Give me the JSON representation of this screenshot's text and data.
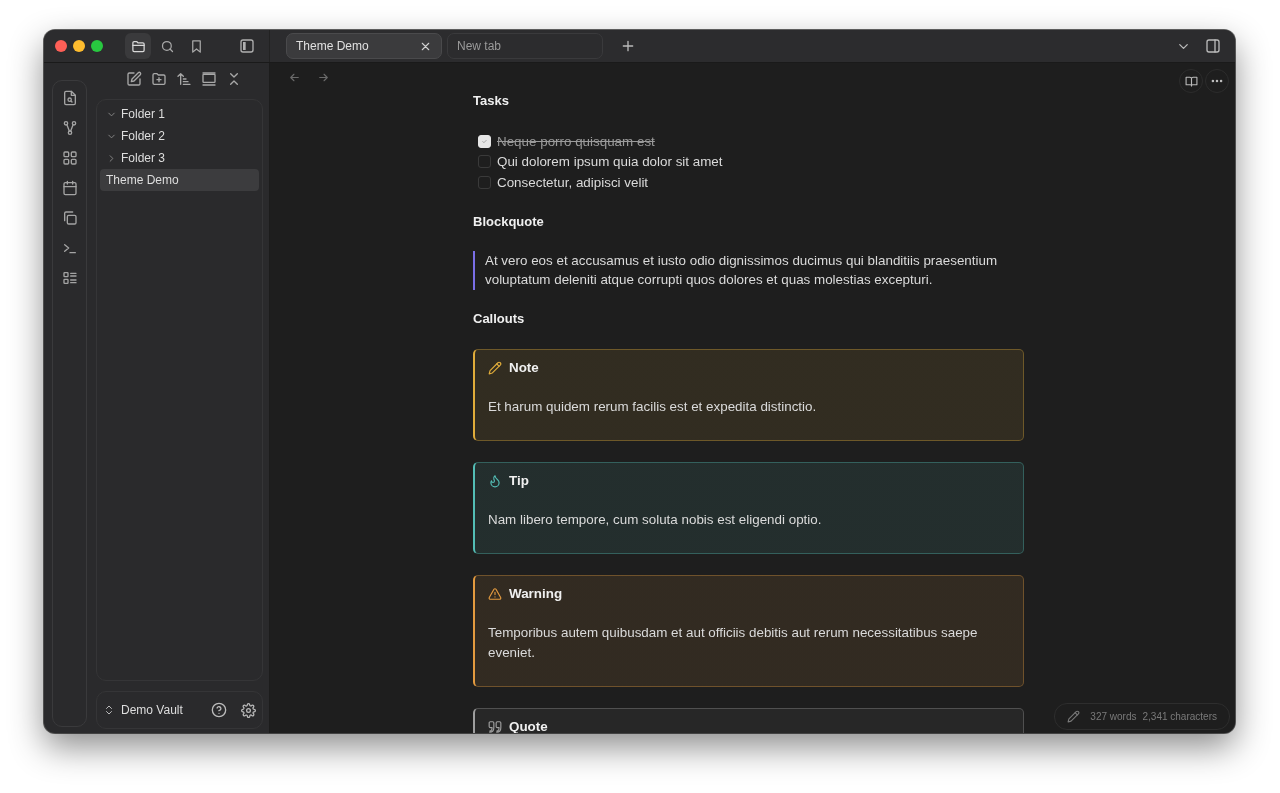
{
  "nav_tabs": [
    {
      "kind": "files",
      "selected": true
    },
    {
      "kind": "search",
      "selected": false
    },
    {
      "kind": "bookmarks",
      "selected": false
    }
  ],
  "tabs": [
    {
      "label": "Theme Demo",
      "selected": true
    },
    {
      "label": "New tab",
      "selected": false
    }
  ],
  "file_tree": [
    {
      "label": "Folder 1",
      "kind": "folder",
      "expanded": true,
      "selected": false
    },
    {
      "label": "Folder 2",
      "kind": "folder",
      "expanded": true,
      "selected": false
    },
    {
      "label": "Folder 3",
      "kind": "folder",
      "expanded": false,
      "selected": false
    },
    {
      "label": "Theme Demo",
      "kind": "file",
      "selected": true
    }
  ],
  "vault": {
    "name": "Demo Vault"
  },
  "note": {
    "sections": [
      {
        "kind": "tasks",
        "heading": "Tasks",
        "tasks": [
          {
            "text": "Neque porro quisquam est",
            "checked": true
          },
          {
            "text": "Qui dolorem ipsum quia dolor sit amet",
            "checked": false
          },
          {
            "text": "Consectetur, adipisci velit",
            "checked": false
          }
        ]
      },
      {
        "kind": "blockquote",
        "heading": "Blockquote",
        "text": "At vero eos et accusamus et iusto odio dignissimos ducimus qui blanditiis praesentium voluptatum deleniti atque corrupti quos dolores et quas molestias excepturi."
      },
      {
        "kind": "callouts",
        "heading": "Callouts",
        "callouts": [
          {
            "kind": "note",
            "title": "Note",
            "text": "Et harum quidem rerum facilis est et expedita distinctio.",
            "color": "#e0ac3a"
          },
          {
            "kind": "tip",
            "title": "Tip",
            "text": "Nam libero tempore, cum soluta nobis est eligendi optio.",
            "color": "#53bdb5"
          },
          {
            "kind": "warning",
            "title": "Warning",
            "text": "Temporibus autem quibusdam et aut officiis debitis aut rerum necessitatibus saepe eveniet.",
            "color": "#e39a3f"
          },
          {
            "kind": "quote",
            "title": "Quote",
            "color": "#9e9e9e"
          }
        ]
      }
    ]
  },
  "status_bar": {
    "words": "327 words",
    "characters": "2,341 characters"
  }
}
